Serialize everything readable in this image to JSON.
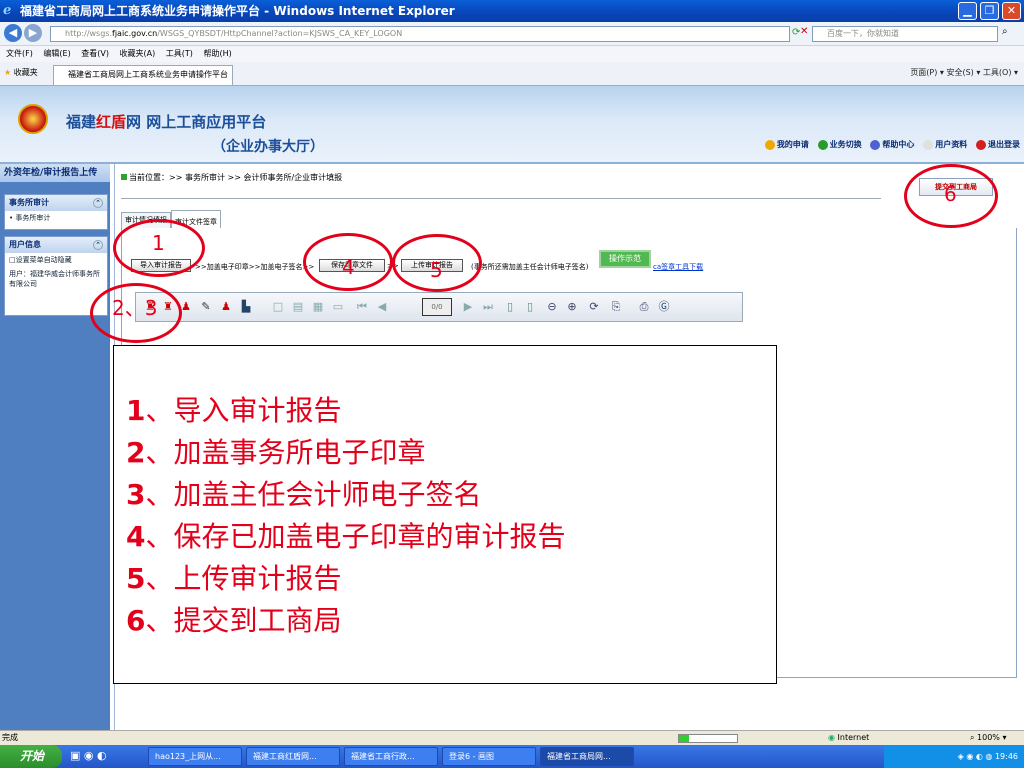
{
  "window": {
    "title": "福建省工商局网上工商系统业务申请操作平台 - Windows Internet Explorer"
  },
  "address_bar": {
    "url_grey": "http://wsgs.",
    "url_domain": "fjaic.gov.cn",
    "url_rest": "/WSGS_QYBSDT/HttpChannel?action=KJSWS_CA_KEY_LOGON",
    "search_placeholder": "百度一下，你就知道"
  },
  "menu": [
    "文件(F)",
    "编辑(E)",
    "查看(V)",
    "收藏夹(A)",
    "工具(T)",
    "帮助(H)"
  ],
  "favorites": {
    "label": "收藏夹",
    "tab_title": "福建省工商局网上工商系统业务申请操作平台",
    "commands": "页面(P) ▾  安全(S) ▾  工具(O) ▾"
  },
  "header": {
    "logo_prefix": "福建",
    "logo_red": "红盾",
    "logo_suffix": "网  网上工商应用平台",
    "logo_sub": "（企业办事大厅）",
    "links": [
      "我的申请",
      "业务切换",
      "帮助中心",
      "用户资料",
      "退出登录"
    ]
  },
  "sidebar": {
    "title": "外资年检/审计报告上传",
    "box1": {
      "title": "事务所审计",
      "item": "• 事务所审计"
    },
    "box2": {
      "title": "用户信息",
      "checkbox_label": "□设置菜单自动隐藏",
      "user": "用户：福建华威会计师事务所有限公司"
    }
  },
  "content": {
    "breadcrumb": "当前位置：>> 事务所审计 >> 会计师事务所/企业审计填报",
    "submit_button": "提交到工商局",
    "tabs": [
      "审计情况填报",
      "审计文件签章"
    ],
    "btn_import": "导入审计报告",
    "step_text1": ">>加盖电子印章>>加盖电子签名>>",
    "btn_save": "保存印章文件",
    "step_text2": ">>",
    "btn_upload": "上传审计报告",
    "note": "(事务所还需加盖主任会计师电子签名)",
    "demo_button": "操作示范",
    "ca_link": "ca签章工具下载",
    "page_indicator": "0/0"
  },
  "annotations": {
    "circle_labels": [
      "1",
      "2、3",
      "4",
      "5",
      "6"
    ],
    "steps": [
      {
        "num": "1",
        "text": "、导入审计报告"
      },
      {
        "num": "2",
        "text": "、加盖事务所电子印章"
      },
      {
        "num": "3",
        "text": "、加盖主任会计师电子签名"
      },
      {
        "num": "4",
        "text": "、保存已加盖电子印章的审计报告"
      },
      {
        "num": "5",
        "text": "、上传审计报告"
      },
      {
        "num": "6",
        "text": "、提交到工商局"
      }
    ],
    "color": "#e3001b"
  },
  "status": {
    "left": "完成",
    "zone": "Internet",
    "zoom": "100%"
  },
  "taskbar": {
    "start": "开始",
    "items": [
      "hao123_上网从...",
      "福建工商红盾网...",
      "福建省工商行政...",
      "登录6 - 画图",
      "福建省工商局网..."
    ],
    "clock": "19:46"
  }
}
